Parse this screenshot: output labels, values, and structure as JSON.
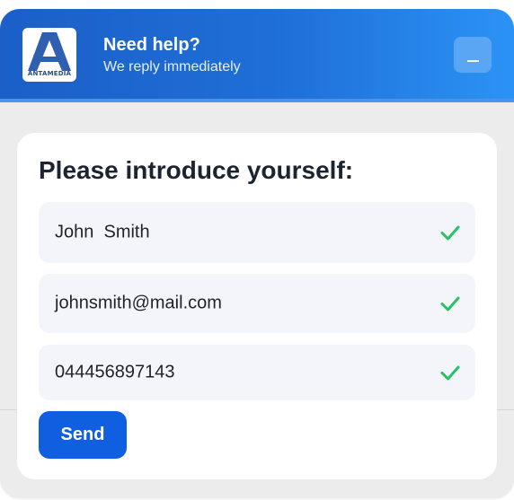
{
  "header": {
    "logo_text": "ANTAMEDIA",
    "title": "Need help?",
    "subtitle": "We reply immediately",
    "minimize_icon": "minimize-icon"
  },
  "form": {
    "title": "Please introduce yourself:",
    "fields": [
      {
        "name": "name",
        "value": "John  Smith",
        "status": "valid"
      },
      {
        "name": "email",
        "value": "johnsmith@mail.com",
        "status": "valid"
      },
      {
        "name": "phone",
        "value": "044456897143",
        "status": "valid"
      }
    ],
    "send_label": "Send"
  },
  "colors": {
    "header_gradient_start": "#1b5fc7",
    "header_gradient_end": "#2b93f5",
    "send_button": "#0f5fe0",
    "check_green": "#27c263",
    "field_bg": "#f4f5fa"
  }
}
